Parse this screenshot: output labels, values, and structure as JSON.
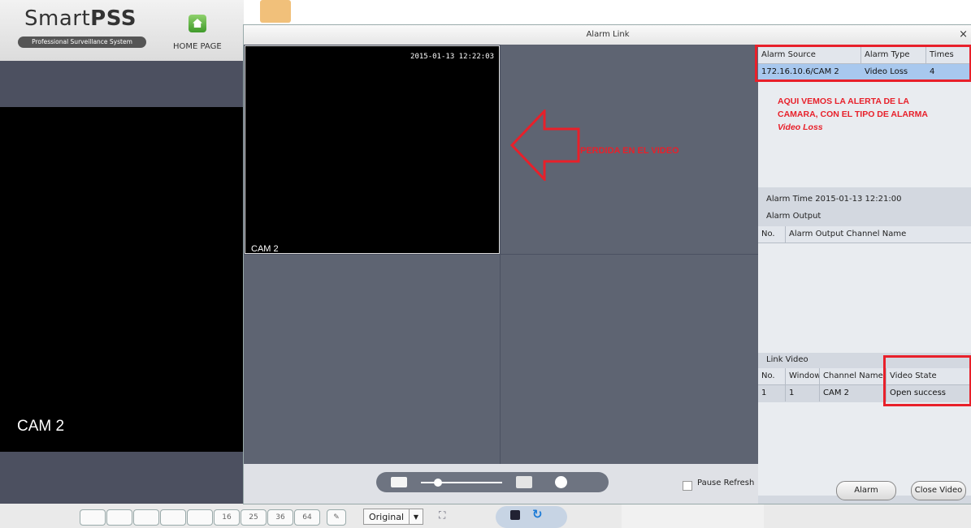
{
  "app": {
    "logo_light": "Smart",
    "logo_bold": "PSS",
    "tagline": "Professional Surveillance System",
    "home_label": "HOME PAGE",
    "background_camera_label": "CAM 2"
  },
  "bottom_toolbar": {
    "layouts": [
      "",
      "",
      "",
      "",
      "",
      "16",
      "25",
      "36",
      "64"
    ],
    "scale_mode": "Original"
  },
  "dialog": {
    "title": "Alarm Link",
    "close_glyph": "×",
    "video": {
      "timestamp": "2015-01-13 12:22:03",
      "camera_label": "CAM 2",
      "annotation": "PERDIDA EN EL VIDEO"
    },
    "pause_refresh_label": "Pause Refresh",
    "alarm_table": {
      "columns": [
        "Alarm Source",
        "Alarm Type",
        "Times"
      ],
      "rows": [
        [
          "172.16.10.6/CAM 2",
          "Video Loss",
          "4"
        ]
      ]
    },
    "annotation_lines": [
      "AQUI VEMOS LA ALERTA DE LA",
      "CAMARA, CON EL TIPO DE ALARMA",
      "Video Loss"
    ],
    "alarm_time_label": "Alarm Time",
    "alarm_time_value": "2015-01-13 12:21:00",
    "alarm_output_label": "Alarm Output",
    "output_table": {
      "columns": [
        "No.",
        "Alarm Output Channel Name"
      ]
    },
    "link_video_label": "Link Video",
    "link_table": {
      "columns": [
        "No.",
        "Window",
        "Channel Name",
        "Video State"
      ],
      "rows": [
        [
          "1",
          "1",
          "CAM 2",
          "Open success"
        ]
      ]
    },
    "alarm_button": "Alarm",
    "close_video_button": "Close Video"
  },
  "colors": {
    "annotation_red": "#e8202a",
    "selected_row": "#a8c8ee"
  }
}
